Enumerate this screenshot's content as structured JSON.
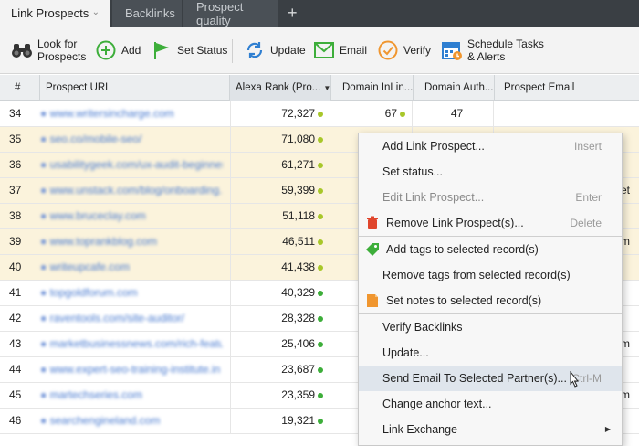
{
  "tabs": [
    {
      "label": "Link Prospects",
      "active": true
    },
    {
      "label": "Backlinks",
      "active": false
    },
    {
      "label": "Prospect quality",
      "active": false
    }
  ],
  "tab_add_glyph": "+",
  "toolbar": {
    "look_for_prospects": [
      "Look for",
      "Prospects"
    ],
    "add": "Add",
    "set_status": "Set Status",
    "update": "Update",
    "email": "Email",
    "verify": "Verify",
    "schedule": [
      "Schedule Tasks",
      "& Alerts"
    ]
  },
  "columns": {
    "num": "#",
    "url": "Prospect URL",
    "alexa": "Alexa Rank (Pro...",
    "inlink": "Domain InLin...",
    "auth": "Domain Auth...",
    "email": "Prospect Email"
  },
  "rows": [
    {
      "num": "34",
      "url": "www.writersincharge.com",
      "alexa": "72,327",
      "alexa_dot": "yellow",
      "inlink": "67",
      "inlink_dot": "yellow",
      "auth": "47",
      "highlighted": false
    },
    {
      "num": "35",
      "url": "seo.co/mobile-seo/",
      "alexa": "71,080",
      "alexa_dot": "yellow",
      "inlink": "",
      "auth": "",
      "highlighted": true
    },
    {
      "num": "36",
      "url": "usabilitygeek.com/ux-audit-beginner...",
      "alexa": "61,271",
      "alexa_dot": "yellow",
      "inlink": "",
      "auth": "",
      "highlighted": true
    },
    {
      "num": "37",
      "url": "www.unstack.com/blog/onboarding...",
      "alexa": "59,399",
      "alexa_dot": "yellow",
      "inlink": "",
      "auth": "",
      "highlighted": true,
      "tail": "et"
    },
    {
      "num": "38",
      "url": "www.bruceclay.com",
      "alexa": "51,118",
      "alexa_dot": "yellow",
      "inlink": "",
      "auth": "",
      "highlighted": true
    },
    {
      "num": "39",
      "url": "www.toprankblog.com",
      "alexa": "46,511",
      "alexa_dot": "yellow",
      "inlink": "",
      "auth": "",
      "highlighted": true,
      "tail": "m"
    },
    {
      "num": "40",
      "url": "writeupcafe.com",
      "alexa": "41,438",
      "alexa_dot": "yellow",
      "inlink": "",
      "auth": "",
      "highlighted": true
    },
    {
      "num": "41",
      "url": "topgoldforum.com",
      "alexa": "40,329",
      "alexa_dot": "green",
      "inlink": "",
      "auth": "",
      "highlighted": false
    },
    {
      "num": "42",
      "url": "raventools.com/site-auditor/",
      "alexa": "28,328",
      "alexa_dot": "green",
      "inlink": "",
      "auth": "",
      "highlighted": false
    },
    {
      "num": "43",
      "url": "marketbusinessnews.com/rich-featu...",
      "alexa": "25,406",
      "alexa_dot": "green",
      "inlink": "",
      "auth": "",
      "highlighted": false,
      "tail": "m"
    },
    {
      "num": "44",
      "url": "www.expert-seo-training-institute.in",
      "alexa": "23,687",
      "alexa_dot": "green",
      "inlink": "",
      "auth": "",
      "highlighted": false
    },
    {
      "num": "45",
      "url": "martechseries.com",
      "alexa": "23,359",
      "alexa_dot": "green",
      "inlink": "",
      "auth": "",
      "highlighted": false,
      "tail": "m"
    },
    {
      "num": "46",
      "url": "searchengineland.com",
      "alexa": "19,321",
      "alexa_dot": "green",
      "inlink": "",
      "auth": "",
      "highlighted": false
    }
  ],
  "context_menu": {
    "items": [
      {
        "label": "Add Link Prospect...",
        "shortcut": "Insert",
        "disabled": false,
        "icon": ""
      },
      {
        "label": "Set status...",
        "shortcut": "",
        "disabled": false,
        "icon": ""
      },
      {
        "label": "Edit Link Prospect...",
        "shortcut": "Enter",
        "disabled": true,
        "icon": ""
      },
      {
        "label": "Remove Link Prospect(s)...",
        "shortcut": "Delete",
        "disabled": false,
        "icon": "trash-icon"
      },
      {
        "sep": true
      },
      {
        "label": "Add tags to selected record(s)",
        "shortcut": "",
        "disabled": false,
        "icon": "tag-icon"
      },
      {
        "label": "Remove tags from selected record(s)",
        "shortcut": "",
        "disabled": false,
        "icon": ""
      },
      {
        "label": "Set notes to selected record(s)",
        "shortcut": "",
        "disabled": false,
        "icon": "note-icon"
      },
      {
        "sep": true
      },
      {
        "label": "Verify Backlinks",
        "shortcut": "",
        "disabled": false,
        "icon": ""
      },
      {
        "label": "Update...",
        "shortcut": "",
        "disabled": false,
        "icon": ""
      },
      {
        "label": "Send Email To Selected Partner(s)...",
        "shortcut": "Ctrl-M",
        "disabled": false,
        "icon": "",
        "hover": true
      },
      {
        "label": "Change anchor text...",
        "shortcut": "",
        "disabled": false,
        "icon": ""
      },
      {
        "label": "Link Exchange",
        "shortcut": "",
        "disabled": false,
        "icon": "",
        "submenu": true
      }
    ]
  },
  "colors": {
    "accent_green": "#3dae3a",
    "accent_yellow": "#a8c72a",
    "row_highlight": "#fbf3dc",
    "menu_hover": "#dfe5ec",
    "tab_bar": "#3a3f44"
  }
}
